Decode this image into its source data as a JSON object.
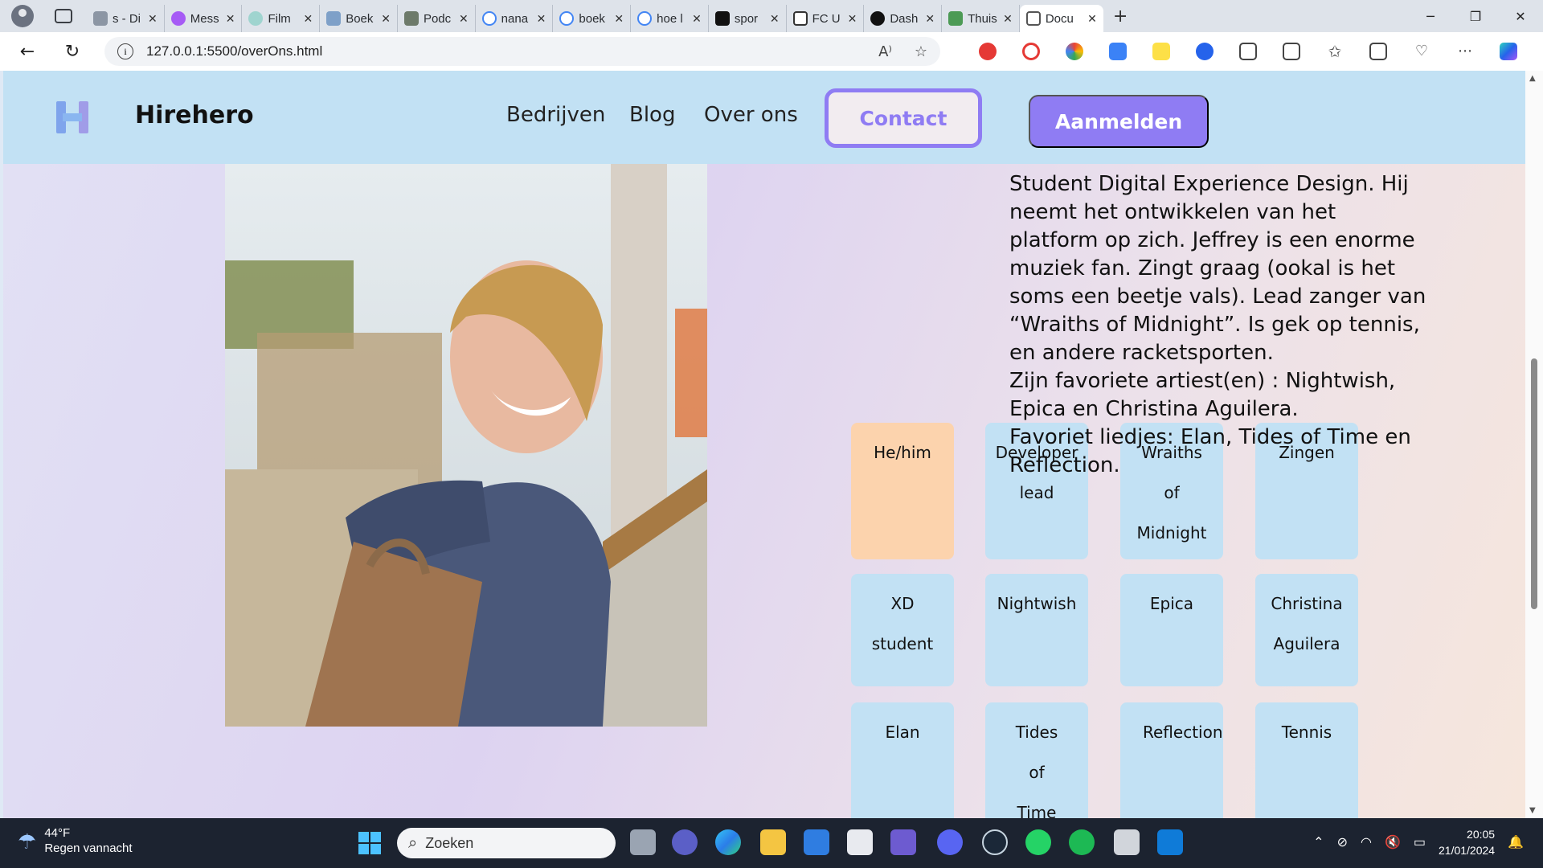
{
  "browser": {
    "tabs": [
      {
        "title": "s - Di"
      },
      {
        "title": "Mess"
      },
      {
        "title": "Film"
      },
      {
        "title": "Boek"
      },
      {
        "title": "Podc"
      },
      {
        "title": "nana"
      },
      {
        "title": "boek"
      },
      {
        "title": "hoe l"
      },
      {
        "title": "spor"
      },
      {
        "title": "FC U"
      },
      {
        "title": "Dash"
      },
      {
        "title": "Thuis"
      },
      {
        "title": "Docu"
      }
    ],
    "address": "127.0.0.1:5500/overOns.html"
  },
  "site": {
    "brand": "Hirehero",
    "nav": [
      "Bedrijven",
      "Blog",
      "Over ons"
    ],
    "contact_label": "Contact",
    "signup_label": "Aanmelden",
    "bio": [
      "Student Digital Experience Design. Hij neemt het ontwikkelen van het platform op zich. Jeffrey is een enorme muziek fan. Zingt graag (ookal is het soms een beetje vals). Lead zanger van “Wraiths of Midnight”. Is gek op tennis, en andere racketsporten.",
      "Zijn favoriete artiest(en) : Nightwish, Epica en Christina Aguilera.",
      "Favoriet liedjes: Elan, Tides of Time en Reflection."
    ],
    "tags": [
      {
        "label": "He/him",
        "peach": true
      },
      {
        "label": "Developer\nlead",
        "peach": false
      },
      {
        "label": "Wraiths\nof\nMidnight",
        "peach": false
      },
      {
        "label": "Zingen",
        "peach": false
      },
      {
        "label": "XD\nstudent",
        "peach": false
      },
      {
        "label": "Nightwish",
        "peach": false
      },
      {
        "label": "Epica",
        "peach": false
      },
      {
        "label": "Christina\nAguilera",
        "peach": false
      },
      {
        "label": "Elan",
        "peach": false
      },
      {
        "label": "Tides\nof\nTime",
        "peach": false
      },
      {
        "label": "Reflection",
        "peach": false
      },
      {
        "label": "Tennis",
        "peach": false
      }
    ],
    "colors": {
      "header": "#c2e1f4",
      "accent": "#8f7cf3",
      "tile": "#c2e1f4",
      "tile_peach": "#fcd3ad"
    }
  },
  "taskbar": {
    "temperature": "44°F",
    "weather": "Regen vannacht",
    "search_placeholder": "Zoeken",
    "time": "20:05",
    "date": "21/01/2024"
  }
}
